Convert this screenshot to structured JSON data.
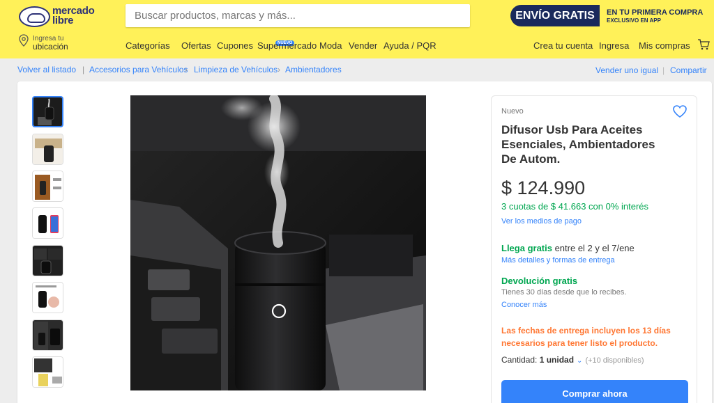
{
  "header": {
    "logo_text": "mercado libre",
    "search": {
      "placeholder": "Buscar productos, marcas y más..."
    },
    "promo": {
      "main": "ENVÍO GRATIS",
      "line1": "EN TU PRIMERA COMPRA",
      "line2": "EXCLUSIVO EN APP"
    },
    "location": {
      "line1": "Ingresa tu",
      "line2": "ubicación"
    },
    "nav": [
      "Categorías",
      "Ofertas",
      "Cupones",
      "Supermercado",
      "Moda",
      "Vender",
      "Ayuda / PQR"
    ],
    "nav_badge": "NUEVO",
    "user_nav": [
      "Crea tu cuenta",
      "Ingresa",
      "Mis compras"
    ],
    "icons": {
      "search": "search-icon",
      "location": "location-pin-icon",
      "cart": "cart-icon",
      "chevron": "chevron-down-icon"
    }
  },
  "breadcrumb": {
    "back": "Volver al listado",
    "items": [
      "Accesorios para Vehículos",
      "Limpieza de Vehículos",
      "Ambientadores"
    ],
    "right": [
      "Vender uno igual",
      "Compartir"
    ]
  },
  "product": {
    "condition": "Nuevo",
    "title": "Difusor Usb Para Aceites Esenciales, Ambientadores De Autom.",
    "price": "$ 124.990",
    "cuotas": "3 cuotas de $ 41.663 con 0% interés",
    "payment_link": "Ver los medios de pago",
    "shipping_bold": "Llega gratis",
    "shipping_text": " entre el 2 y el 7/ene",
    "shipping_link": "Más detalles y formas de entrega",
    "return_title": "Devolución gratis",
    "return_sub": "Tienes 30 días desde que lo recibes.",
    "return_link": "Conocer más",
    "warning": "Las fechas de entrega incluyen los 13 días necesarios para tener listo el producto.",
    "qty_label": "Cantidad: ",
    "qty_value": "1 unidad",
    "qty_avail": "(+10 disponibles)",
    "buy_label": "Comprar ahora",
    "thumbnail_count": 8,
    "active_thumbnail": 1,
    "colors": {
      "accent": "#3483fa",
      "green": "#00a650",
      "orange": "#ff7733",
      "header": "#fff159"
    }
  }
}
